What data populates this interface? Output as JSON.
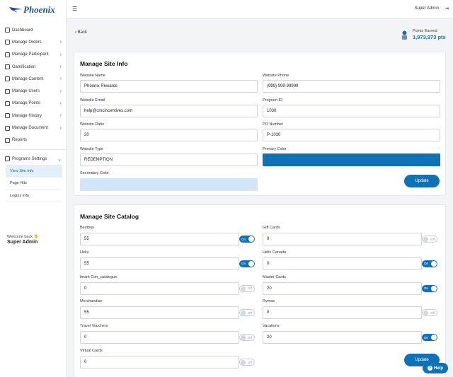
{
  "brand": {
    "name": "Phoenix"
  },
  "sidebar": {
    "items": [
      {
        "label": "Dashboard",
        "icon": "dashboard-icon",
        "chevron": false
      },
      {
        "label": "Manage Orders",
        "icon": "list-icon",
        "chevron": true
      },
      {
        "label": "Manage Participant",
        "icon": "participant-icon",
        "chevron": true
      },
      {
        "label": "Gamification",
        "icon": "gamepad-icon",
        "chevron": true
      },
      {
        "label": "Manage Content",
        "icon": "content-icon",
        "chevron": true
      },
      {
        "label": "Manage Users",
        "icon": "users-icon",
        "chevron": true
      },
      {
        "label": "Manage Points",
        "icon": "points-icon",
        "chevron": true
      },
      {
        "label": "Manage History",
        "icon": "history-icon",
        "chevron": true
      },
      {
        "label": "Manage Document",
        "icon": "document-icon",
        "chevron": true
      },
      {
        "label": "Reports",
        "icon": "reports-icon",
        "chevron": false
      }
    ],
    "programs": {
      "label": "Programs Settings",
      "sub": [
        "View Site Info",
        "Page Hits",
        "Logins Info"
      ]
    },
    "welcome": "Welcome back",
    "user": "Super Admin"
  },
  "topbar": {
    "user": "Super Admin"
  },
  "back": "Back",
  "points": {
    "label": "Points Earned",
    "value": "1,973,973 pts"
  },
  "site_info": {
    "title": "Manage Site Info",
    "website_name": {
      "label": "Website Name",
      "value": "Phoenix Rewards"
    },
    "website_phone": {
      "label": "Website Phone",
      "value": "(999) 999-99999"
    },
    "website_email": {
      "label": "Website Email",
      "value": "help@cmcincentives.com"
    },
    "program_id": {
      "label": "Program ID",
      "value": "1030"
    },
    "website_ratio": {
      "label": "Website Ratio",
      "value": "20"
    },
    "po_number": {
      "label": "PO Number",
      "value": "P-1030"
    },
    "website_type": {
      "label": "Website Type",
      "value": "REDEMPTION"
    },
    "primary_color": {
      "label": "Primary Color",
      "color": "#1171b5"
    },
    "secondary_color": {
      "label": "Secondary Color",
      "color": "#d2e6f7"
    },
    "update": "Update"
  },
  "catalog": {
    "title": "Manage Site Catalog",
    "on": "On",
    "off": "Off",
    "left": [
      {
        "label": "Bestbuy",
        "value": "55",
        "on": true
      },
      {
        "label": "Helix",
        "value": "55",
        "on": true
      },
      {
        "label": "Imark Coh_catalogue",
        "value": "0",
        "on": false
      },
      {
        "label": "Merchandise",
        "value": "55",
        "on": false
      },
      {
        "label": "Travel Vouchers",
        "value": "0",
        "on": false
      },
      {
        "label": "Virtual Cards",
        "value": "0",
        "on": false
      }
    ],
    "right": [
      {
        "label": "Gift Cards",
        "value": "0",
        "on": false
      },
      {
        "label": "Helix Canada",
        "value": "0",
        "on": true
      },
      {
        "label": "Master Cards",
        "value": "20",
        "on": true
      },
      {
        "label": "Rymax",
        "value": "0",
        "on": false
      },
      {
        "label": "Vacations",
        "value": "20",
        "on": true
      }
    ],
    "update": "Update"
  },
  "help": "Help"
}
